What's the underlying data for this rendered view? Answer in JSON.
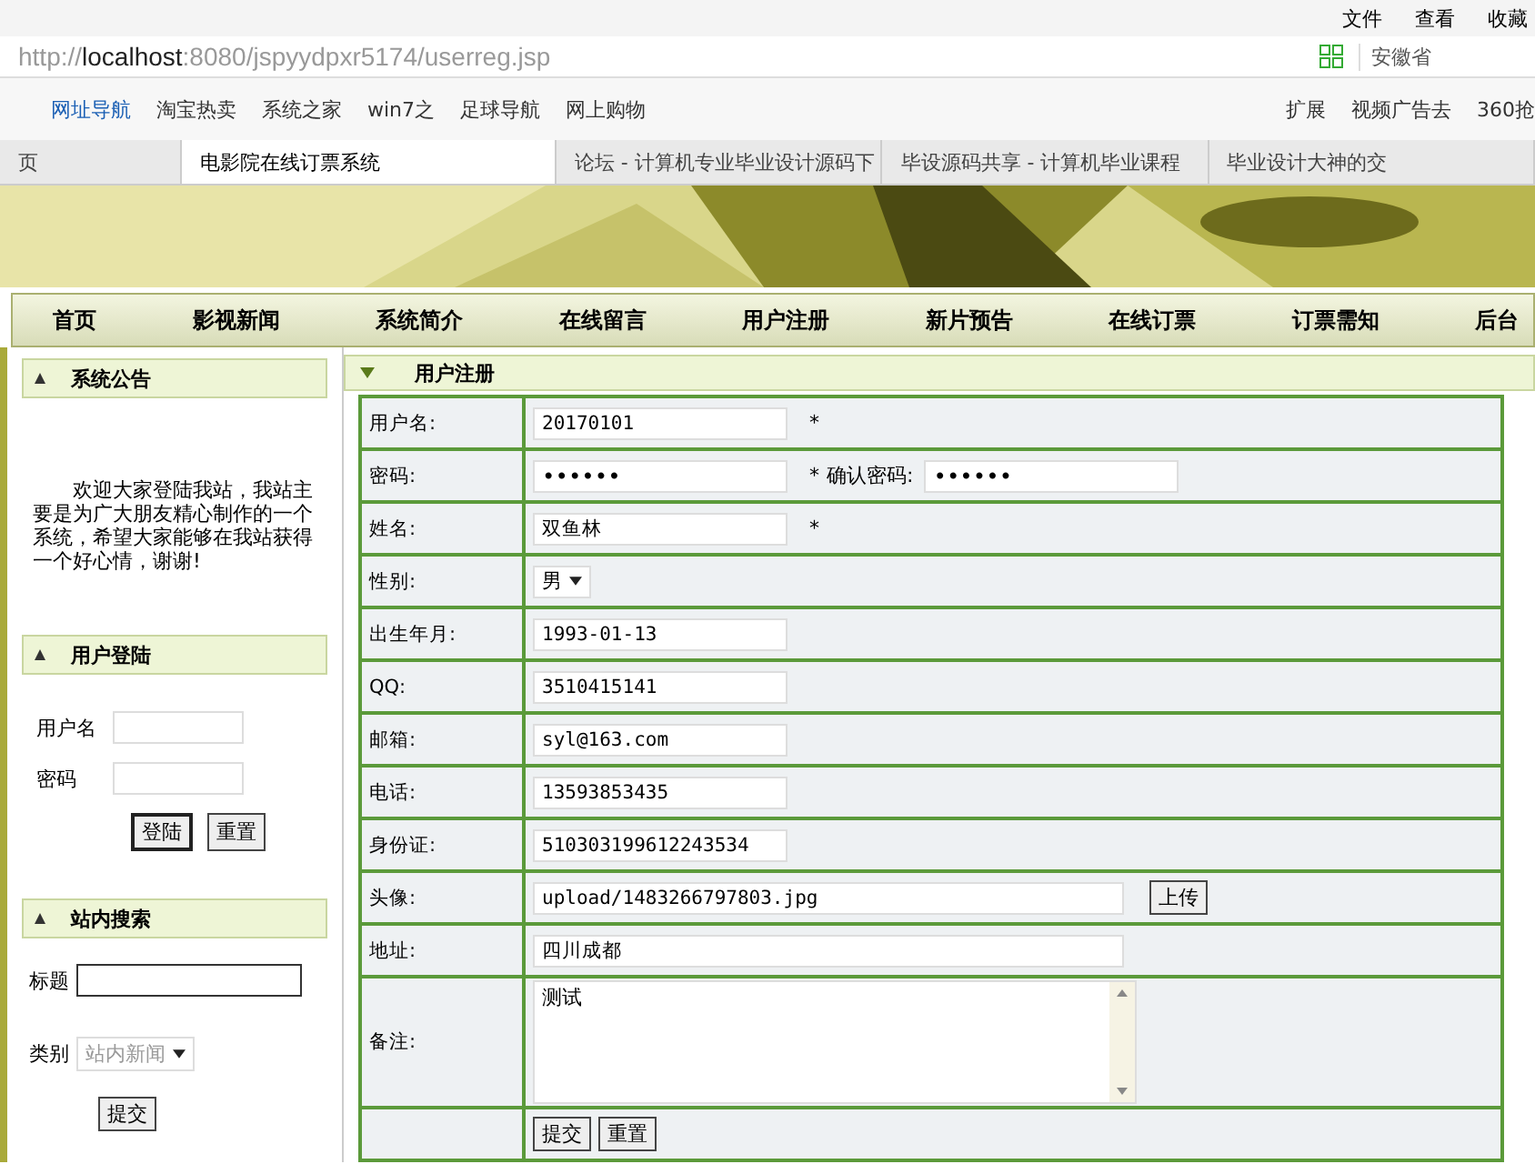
{
  "browser": {
    "menu": [
      "文件",
      "查看",
      "收藏"
    ],
    "address": {
      "scheme": "http://",
      "host": "localhost",
      "rest": ":8080/jspyydpxr5174/userreg.jsp"
    },
    "search": "安徽省",
    "bookmarks": [
      "网址导航",
      "淘宝热卖",
      "系统之家",
      "win7之",
      "足球导航",
      "网上购物"
    ],
    "extras": [
      "扩展",
      "视频广告去",
      "360抢"
    ],
    "tabs": [
      {
        "title": "页",
        "selected": false
      },
      {
        "title": "电影院在线订票系统",
        "selected": true
      },
      {
        "title": "论坛 - 计算机专业毕业设计源码下",
        "selected": false
      },
      {
        "title": "毕设源码共享 - 计算机毕业课程",
        "selected": false
      },
      {
        "title": "毕业设计大神的交",
        "selected": false
      }
    ]
  },
  "nav": [
    "首页",
    "影视新闻",
    "系统简介",
    "在线留言",
    "用户注册",
    "新片预告",
    "在线订票",
    "订票需知",
    "后台"
  ],
  "sidebar": {
    "notice_title": "系统公告",
    "notice": "欢迎大家登陆我站，我站主要是为广大朋友精心制作的一个系统，希望大家能够在我站获得一个好心情，谢谢!",
    "login_title": "用户登陆",
    "login_fields": [
      {
        "label": "用户名"
      },
      {
        "label": "密码"
      }
    ],
    "login_buttons": [
      "登陆",
      "重置"
    ],
    "search_title": "站内搜索",
    "title_label": "标题",
    "category_label": "类别",
    "category": "站内新闻",
    "search_button": "提交"
  },
  "form": {
    "title": "用户注册",
    "rows": [
      {
        "kind": "text",
        "label": "用户名:",
        "value": "20170101",
        "mark": "*"
      },
      {
        "kind": "password",
        "label": "密码:",
        "value": "••••••",
        "mark": "*",
        "confirm_label": "确认密码:",
        "confirm_value": "••••••"
      },
      {
        "kind": "text",
        "label": "姓名:",
        "value": "双鱼林",
        "mark": "*"
      },
      {
        "kind": "select",
        "label": "性别:",
        "value": "男"
      },
      {
        "kind": "text",
        "label": "出生年月:",
        "value": "1993-01-13"
      },
      {
        "kind": "text",
        "label": "QQ:",
        "value": "3510415141"
      },
      {
        "kind": "text",
        "label": "邮箱:",
        "value": "syl@163.com"
      },
      {
        "kind": "text",
        "label": "电话:",
        "value": "13593853435"
      },
      {
        "kind": "text",
        "label": "身份证:",
        "value": "510303199612243534"
      },
      {
        "kind": "upload",
        "label": "头像:",
        "value": "upload/1483266797803.jpg",
        "button": "上传"
      },
      {
        "kind": "wide",
        "label": "地址:",
        "value": "四川成都"
      },
      {
        "kind": "textarea",
        "label": "备注:",
        "value": "测试"
      }
    ],
    "buttons": [
      "提交",
      "重置"
    ]
  }
}
